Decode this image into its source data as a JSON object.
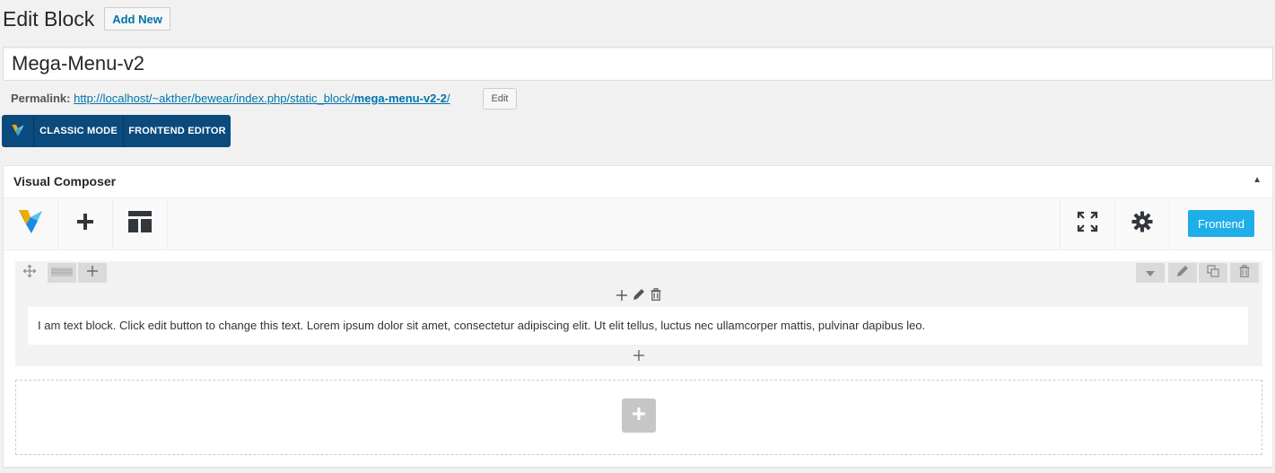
{
  "header": {
    "title": "Edit Block",
    "add_new_label": "Add New"
  },
  "post_title": {
    "value": "Mega-Menu-v2"
  },
  "permalink": {
    "label": "Permalink:",
    "url_base": "http://localhost/~akther/bewear/index.php/static_block/",
    "slug": "mega-menu-v2-2",
    "url_end": "/",
    "edit_label": "Edit"
  },
  "mode_bar": {
    "logo_icon": "vc-logo-icon",
    "classic_label": "CLASSIC MODE",
    "frontend_label": "FRONTEND EDITOR",
    "background": "#0b4a7c"
  },
  "composer": {
    "title": "Visual Composer",
    "toggle_icon": "collapse-arrow-icon",
    "toolbar": {
      "left_icons": [
        "vc-logo-icon",
        "add-element-icon",
        "templates-icon"
      ],
      "right_icons": [
        "fullscreen-icon",
        "settings-icon"
      ],
      "frontend_label": "Frontend",
      "frontend_color": "#1eaee8"
    },
    "row": {
      "left_controls": [
        "move-icon",
        "row-layout-icon",
        "add-column-icon"
      ],
      "right_controls": [
        "dropdown-icon",
        "edit-icon",
        "clone-icon",
        "delete-icon"
      ],
      "column_controls": [
        "add-icon",
        "edit-icon",
        "delete-icon"
      ],
      "text_block": "I am text block. Click edit button to change this text. Lorem ipsum dolor sit amet, consectetur adipiscing elit. Ut elit tellus, luctus nec ullamcorper mattis, pulvinar dapibus leo.",
      "add_below_icon": "add-icon"
    },
    "empty_row": {
      "add_icon": "add-element-icon"
    }
  }
}
